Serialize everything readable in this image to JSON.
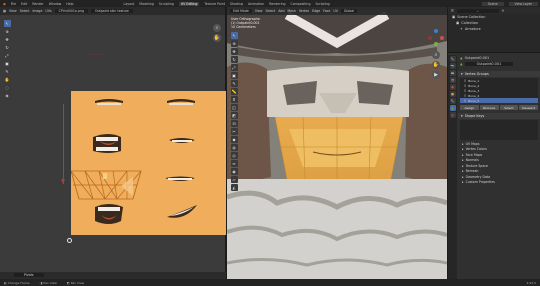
{
  "menu": [
    "File",
    "Edit",
    "Render",
    "Window",
    "Help"
  ],
  "workspaces": [
    "Layout",
    "Modeling",
    "Sculpting",
    "UV Editing",
    "Texture Paint",
    "Shading",
    "Animation",
    "Rendering",
    "Compositing",
    "Scripting"
  ],
  "active_workspace": "UV Editing",
  "scene_label": "Scene",
  "view_layer_label": "View Layer",
  "uv_editor": {
    "mode": "UV Editor",
    "menus": [
      "View",
      "Select",
      "Image",
      "UVs"
    ],
    "image_name": "CPVx0001a.png",
    "overlay_label": "Outpaint skin texture",
    "side_marker": "- - - - - - - - -",
    "mouth_texture_color": "#f0ad5c"
  },
  "viewport": {
    "mode": "Edit Mode",
    "menus": [
      "View",
      "Select",
      "Add",
      "Mesh",
      "Vertex",
      "Edge",
      "Face",
      "UV"
    ],
    "projection": "User Orthographic",
    "object_info": "(1) Outpaint0.001",
    "units": "10 Centimeters",
    "shading": "Global"
  },
  "outliner": {
    "title": "Scene Collection",
    "items": [
      "Collection",
      "Armature"
    ]
  },
  "properties": {
    "object_name": "Outpaint0.001",
    "data_name": "Outpaint0.001",
    "section_vertex_groups": "Vertex Groups",
    "vertex_groups": [
      "Bone_1",
      "Bone_2",
      "Bone_3",
      "Bone_4",
      "Bone_5"
    ],
    "buttons": [
      "Assign",
      "Remove",
      "Select",
      "Deselect"
    ],
    "section_shape_keys": "Shape Keys",
    "sections": [
      "UV Maps",
      "Vertex Colors",
      "Face Maps",
      "Normals",
      "Texture Space",
      "Remesh",
      "Geometry Data",
      "Custom Properties"
    ]
  },
  "uv_footer": "Pivots",
  "status": {
    "items": [
      "Change Frame",
      "Pan View",
      "Pan View"
    ],
    "version": "2.93.5"
  }
}
